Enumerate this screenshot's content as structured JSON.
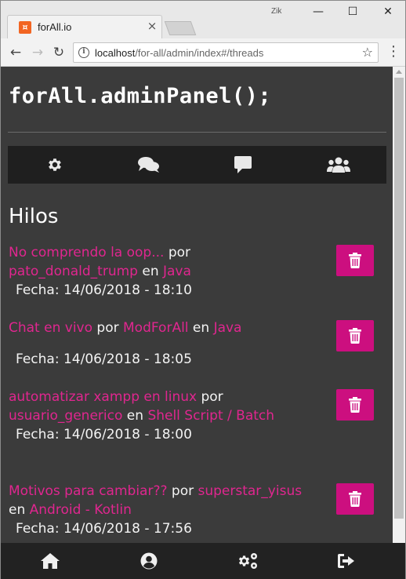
{
  "browser": {
    "tab_title": "forAll.io",
    "favicon_glyph": "¤",
    "tab_close_glyph": "×",
    "user_label": "Zik",
    "minimize_glyph": "—",
    "maximize_glyph": "☐",
    "close_glyph": "✕",
    "back_glyph": "←",
    "forward_glyph": "→",
    "reload_glyph": "↻",
    "info_glyph": "i",
    "url_host": "localhost",
    "url_path": "/for-all/admin/index#/threads",
    "star_glyph": "☆",
    "menu_glyph": "⋮"
  },
  "app": {
    "title": "forAll.adminPanel();",
    "section_title": "Hilos",
    "nav_icons": [
      "gear-icon",
      "comments-icon",
      "comment-icon",
      "users-icon"
    ],
    "accent_color": "#e0268f",
    "delete_color": "#cc0f7f"
  },
  "threads": [
    {
      "title": "No comprendo la oop...",
      "by": "por",
      "author": "pato_donald_trump",
      "in": "en",
      "category": "Java",
      "date": "Fecha: 14/06/2018 - 18:10"
    },
    {
      "title": "Chat en vivo",
      "by": "por",
      "author": "ModForAll",
      "in": "en",
      "category": "Java",
      "date": "Fecha: 14/06/2018 - 18:05"
    },
    {
      "title": "automatizar xampp en linux",
      "by": "por",
      "author": "usuario_generico",
      "in": "en",
      "category": "Shell Script / Batch",
      "date": "Fecha: 14/06/2018 - 18:00"
    },
    {
      "title": "Motivos para cambiar??",
      "by": "por",
      "author": "superstar_yisus",
      "in": "en",
      "category": "Android - Kotlin",
      "date": "Fecha: 14/06/2018 - 17:56"
    }
  ],
  "bottom_nav": [
    "home-icon",
    "user-circle-icon",
    "cogs-icon",
    "sign-out-icon"
  ]
}
